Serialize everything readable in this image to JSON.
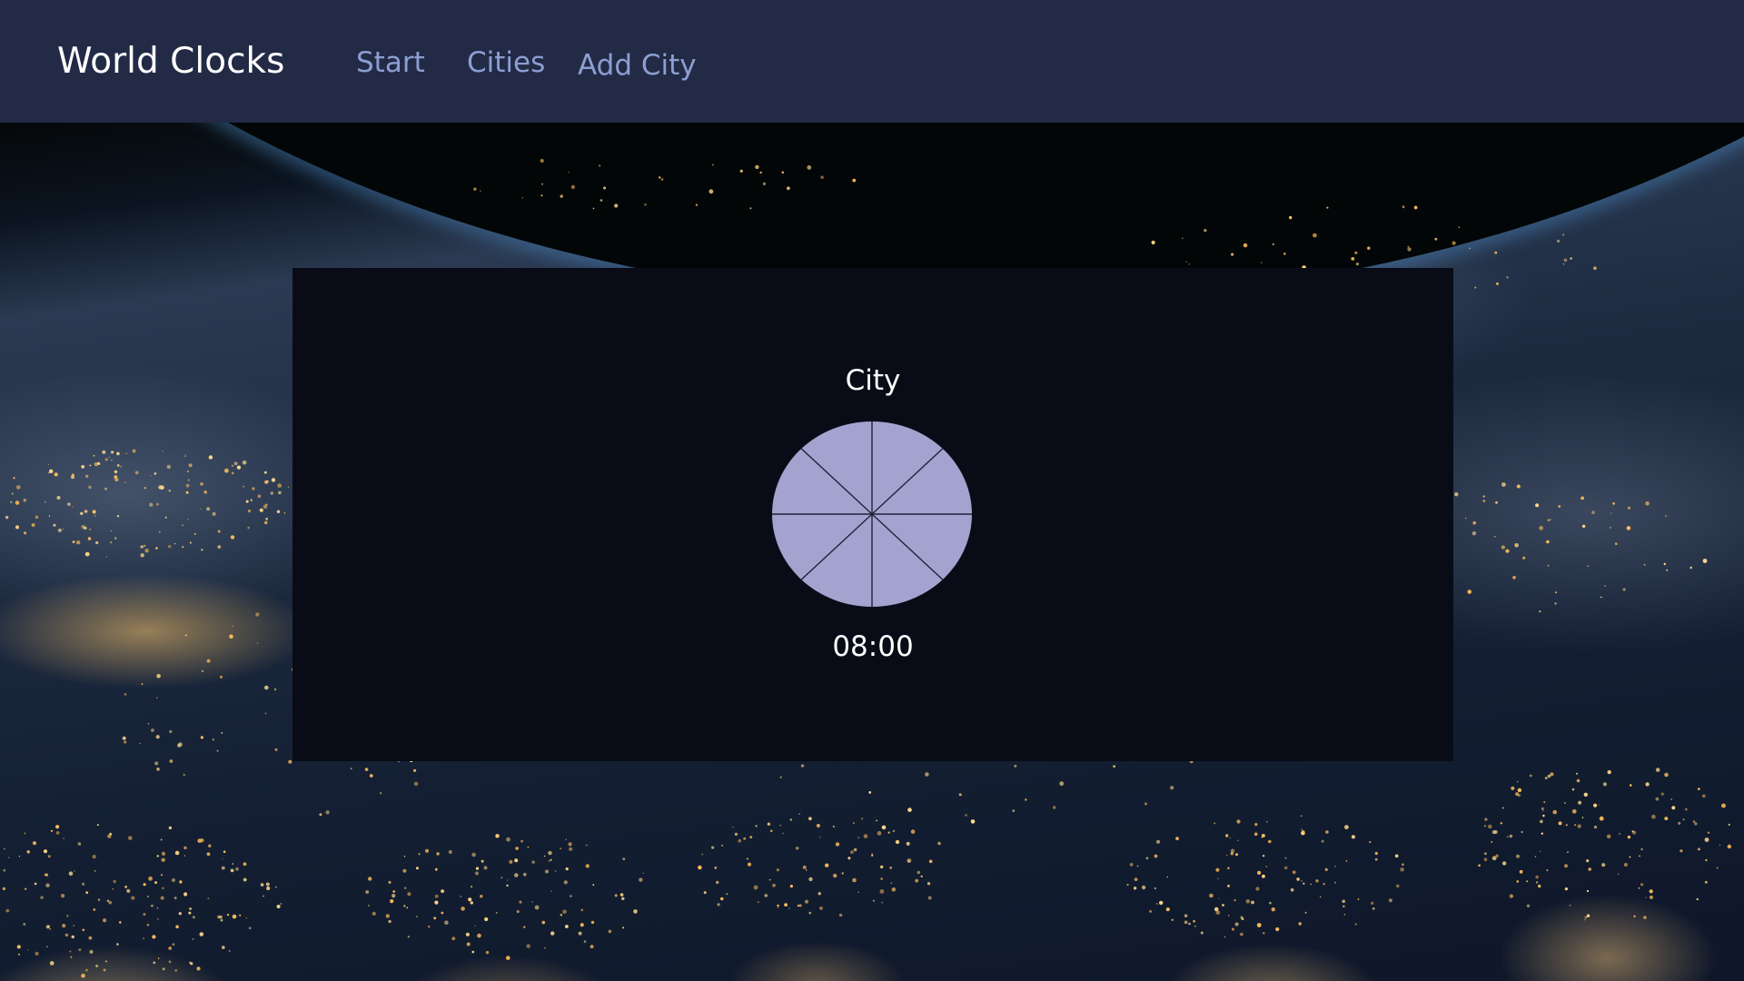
{
  "header": {
    "brand": "World Clocks",
    "nav": [
      {
        "label": "Start"
      },
      {
        "label": "Cities"
      },
      {
        "label": "Add City"
      }
    ]
  },
  "clock": {
    "city": "City",
    "time": "08:00",
    "dial_color": "#a4a3cf"
  },
  "theme": {
    "navbar_bg": "#222a46",
    "nav_link": "#8c9fd1",
    "panel_bg": "#090c17"
  }
}
